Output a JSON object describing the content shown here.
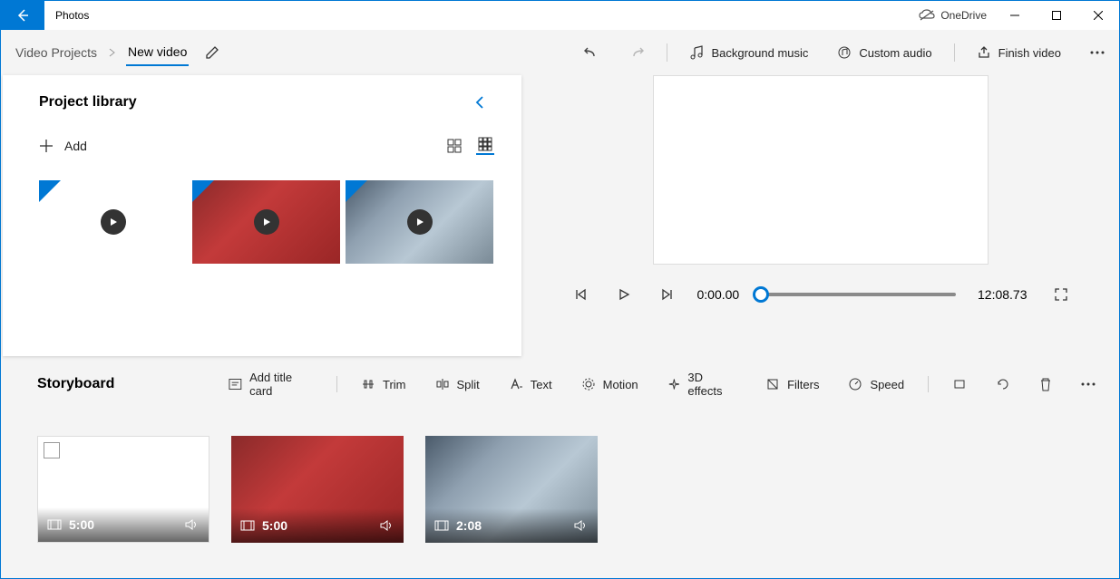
{
  "titlebar": {
    "app_name": "Photos",
    "cloud": "OneDrive"
  },
  "breadcrumb": {
    "root": "Video Projects",
    "current": "New video"
  },
  "toolbar": {
    "bg_music": "Background music",
    "custom_audio": "Custom audio",
    "finish": "Finish video"
  },
  "library": {
    "title": "Project library",
    "add": "Add"
  },
  "preview": {
    "current_time": "0:00.00",
    "total_time": "12:08.73"
  },
  "storyboard": {
    "title": "Storyboard",
    "add_title_card": "Add title card",
    "trim": "Trim",
    "split": "Split",
    "text": "Text",
    "motion": "Motion",
    "effects3d": "3D effects",
    "filters": "Filters",
    "speed": "Speed",
    "clips": [
      {
        "duration": "5:00"
      },
      {
        "duration": "5:00"
      },
      {
        "duration": "2:08"
      }
    ]
  }
}
